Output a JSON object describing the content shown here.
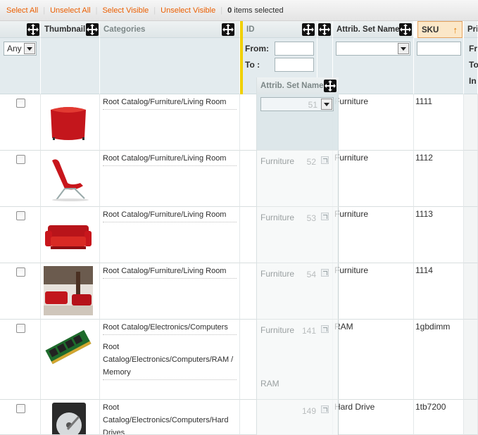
{
  "massaction": {
    "select_all": "Select All",
    "unselect_all": "Unselect All",
    "select_visible": "Select Visible",
    "unselect_visible": "Unselect Visible",
    "separator": "|",
    "selected_count": "0",
    "selected_suffix": "items selected"
  },
  "headers": {
    "thumbnail": "Thumbnail",
    "categories": "Categories",
    "id": "ID",
    "attrib_set_name": "Attrib. Set Name",
    "sku": "SKU",
    "price": "Pri",
    "sort_arrow": "↑"
  },
  "filters": {
    "any": "Any",
    "from_label": "From:",
    "to_label": "To :",
    "price_from": "Fr",
    "price_to": "To",
    "price_in": "In"
  },
  "floating_column": {
    "header": "Attrib. Set Name",
    "cells": [
      {
        "name": "",
        "id": "51"
      },
      {
        "name": "Furniture",
        "id": "52"
      },
      {
        "name": "Furniture",
        "id": "53"
      },
      {
        "name": "Furniture",
        "id": "54"
      },
      {
        "name": "Furniture",
        "id": "141",
        "extra": "RAM"
      },
      {
        "name": "",
        "id": "149"
      }
    ]
  },
  "rows": [
    {
      "categories": [
        "Root Catalog/Furniture/Living Room"
      ],
      "attrib_set": "Furniture",
      "sku": "1111"
    },
    {
      "categories": [
        "Root Catalog/Furniture/Living Room"
      ],
      "attrib_set": "Furniture",
      "sku": "1112"
    },
    {
      "categories": [
        "Root Catalog/Furniture/Living Room"
      ],
      "attrib_set": "Furniture",
      "sku": "1113"
    },
    {
      "categories": [
        "Root Catalog/Furniture/Living Room"
      ],
      "attrib_set": "Furniture",
      "sku": "1114"
    },
    {
      "categories": [
        "Root Catalog/Electronics/Computers",
        "Root Catalog/Electronics/Computers/RAM / Memory"
      ],
      "attrib_set": "RAM",
      "sku": "1gbdimm"
    },
    {
      "categories": [
        "Root Catalog/Electronics/Computers/Hard Drives"
      ],
      "attrib_set": "Hard Drive",
      "sku": "1tb7200"
    }
  ],
  "colors": {
    "link_orange": "#eb5e00",
    "header_bg": "#e3ebee",
    "sort_active_bg": "#fbe7c8",
    "id_column_marker": "#f0d000"
  }
}
